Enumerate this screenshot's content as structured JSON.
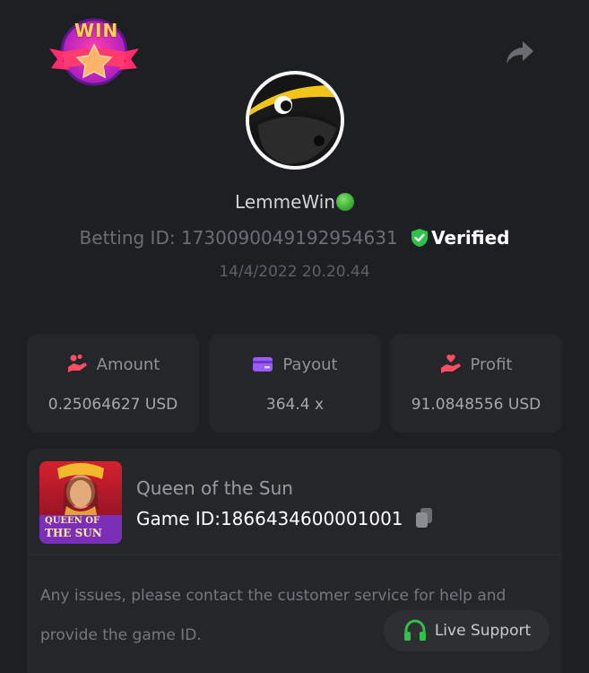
{
  "badge": {
    "text": "WIN"
  },
  "player": {
    "username": "LemmeWin",
    "betting_id_label": "Betting ID:",
    "betting_id": "173009004919295​4631",
    "verified_label": "Verified",
    "timestamp": "14/4/2022 20.20.44"
  },
  "stats": {
    "amount": {
      "label": "Amount",
      "value": "0.25064627 USD",
      "icon": "hand-coins-icon"
    },
    "payout": {
      "label": "Payout",
      "value": "364.4 x",
      "icon": "wallet-card-icon"
    },
    "profit": {
      "label": "Profit",
      "value": "91.0848556 USD",
      "icon": "hand-heart-icon"
    }
  },
  "game": {
    "title": "Queen of the Sun",
    "game_id_label": "Game ID:",
    "game_id": "1866434600001001",
    "thumb_text_line1": "QUEEN OF",
    "thumb_text_line2": "THE SUN"
  },
  "notice": "Any issues, please contact the customer service for help and provide the game ID.",
  "support_button": "Live Support",
  "colors": {
    "background": "#1e1f22",
    "card": "#25262a",
    "verified_green": "#2ec24a",
    "accent_red": "#ff4d63",
    "accent_purple": "#9b5cf6"
  }
}
